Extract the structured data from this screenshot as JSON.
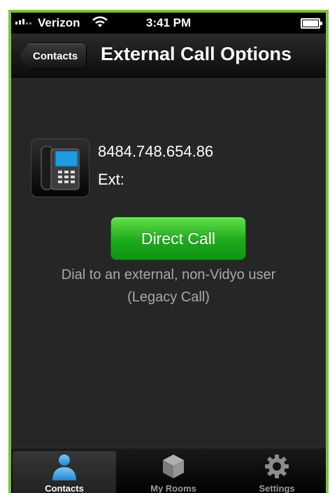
{
  "status_bar": {
    "carrier": "Verizon",
    "time": "3:41 PM"
  },
  "nav": {
    "back_label": "Contacts",
    "title": "External Call Options"
  },
  "contact": {
    "icon": "desk-phone-icon",
    "number": "8484.748.654.86",
    "ext_label": "Ext:"
  },
  "call": {
    "button_label": "Direct Call",
    "description_line1": "Dial to an external, non-Vidyo user",
    "description_line2": "(Legacy Call)"
  },
  "tabs": [
    {
      "label": "Contacts",
      "icon": "person-icon",
      "active": true
    },
    {
      "label": "My Rooms",
      "icon": "cube-icon",
      "active": false
    },
    {
      "label": "Settings",
      "icon": "gear-icon",
      "active": false
    }
  ],
  "colors": {
    "accent_green": "#1eaa1c",
    "frame_green": "#7dc142",
    "tab_active_blue": "#3aa0e8"
  }
}
